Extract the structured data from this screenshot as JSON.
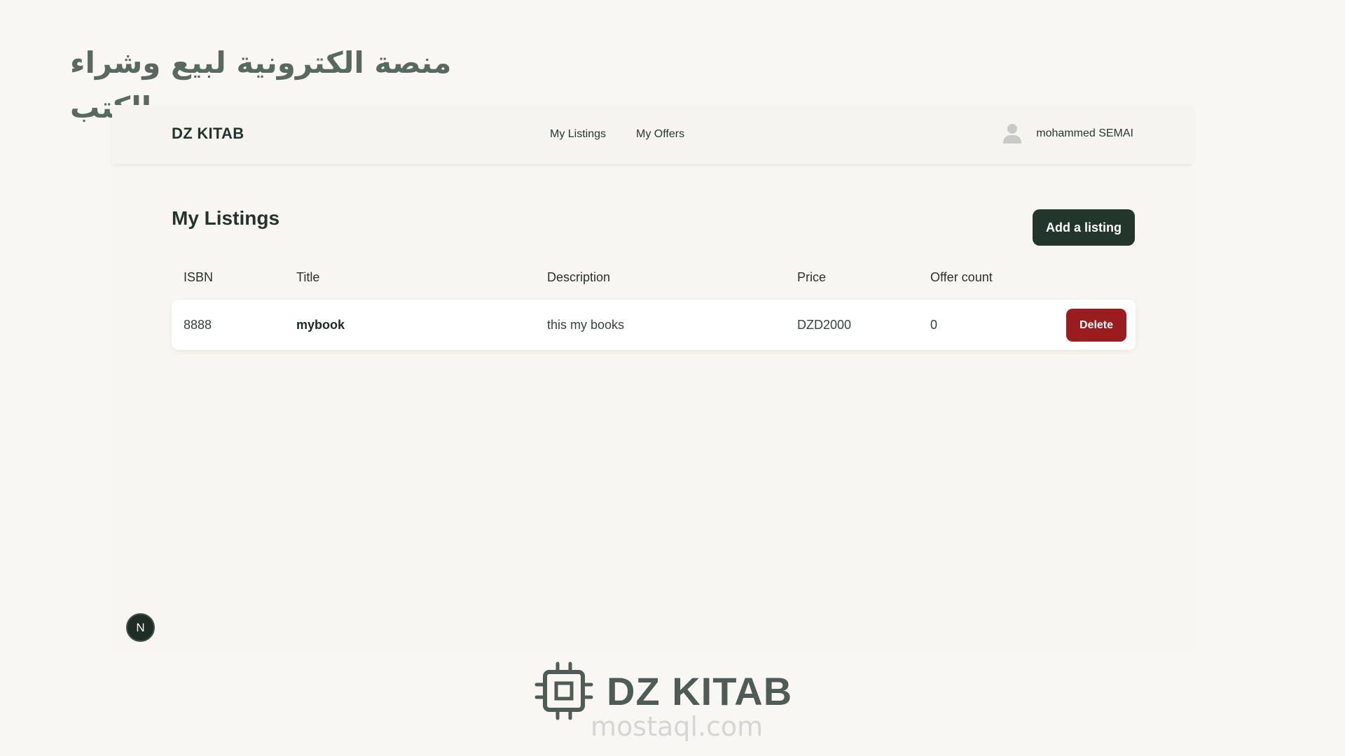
{
  "promo": {
    "heading": "منصة الكترونية لبيع وشراء الكتب"
  },
  "navbar": {
    "brand": "DZ KITAB",
    "links": [
      {
        "label": "My Listings"
      },
      {
        "label": "My Offers"
      }
    ],
    "user": {
      "name": "mohammed SEMAI",
      "icon": "user-icon"
    }
  },
  "page": {
    "title": "My Listings",
    "add_button_label": "Add a listing"
  },
  "table": {
    "columns": [
      "ISBN",
      "Title",
      "Description",
      "Price",
      "Offer count"
    ],
    "rows": [
      {
        "isbn": "8888",
        "title": "mybook",
        "description": "this my books",
        "price": "DZD2000",
        "offer_count": "0",
        "delete_label": "Delete"
      }
    ]
  },
  "badge": {
    "letter": "N"
  },
  "footer": {
    "brand": "DZ KITAB",
    "icon": "chip-icon",
    "watermark": "mostaql.com"
  },
  "colors": {
    "primary": "#22362c",
    "danger": "#9b1c1c",
    "background": "#f9f7f4"
  }
}
